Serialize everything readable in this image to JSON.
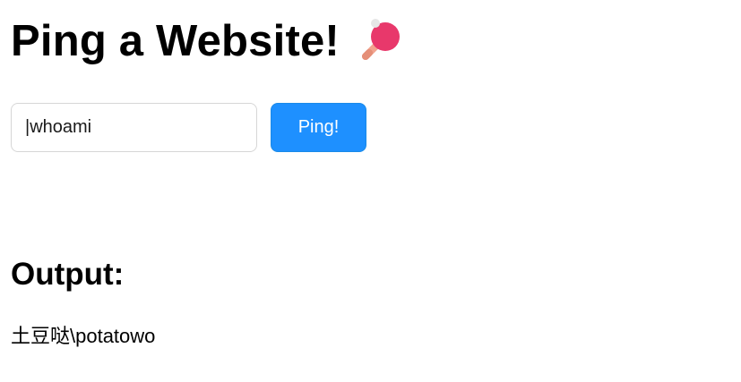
{
  "header": {
    "title": "Ping a Website!",
    "icon": "ping-pong-paddle-icon"
  },
  "form": {
    "input_value": "|whoami",
    "button_label": "Ping!"
  },
  "output": {
    "heading": "Output:",
    "text": "土豆哒\\potatowo"
  },
  "colors": {
    "button_bg": "#1e90ff",
    "button_text": "#ffffff",
    "paddle": "#e8386b",
    "paddle_handle": "#f2a48f",
    "ball": "#e6e6e6"
  }
}
